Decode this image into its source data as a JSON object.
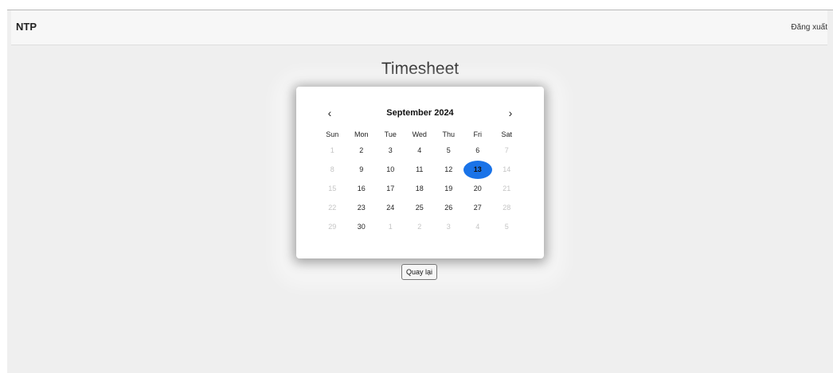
{
  "navbar": {
    "brand": "NTP",
    "logout_label": "Đăng xuất"
  },
  "page": {
    "title": "Timesheet"
  },
  "calendar": {
    "prev_icon": "chevron-left-icon",
    "next_icon": "chevron-right-icon",
    "month_label": "September 2024",
    "weekdays": [
      "Sun",
      "Mon",
      "Tue",
      "Wed",
      "Thu",
      "Fri",
      "Sat"
    ],
    "selected_day": "13",
    "selected_color": "#1a73e8",
    "weeks": [
      [
        {
          "d": "1",
          "muted": true
        },
        {
          "d": "2"
        },
        {
          "d": "3"
        },
        {
          "d": "4"
        },
        {
          "d": "5"
        },
        {
          "d": "6"
        },
        {
          "d": "7",
          "muted": true
        }
      ],
      [
        {
          "d": "8",
          "muted": true
        },
        {
          "d": "9"
        },
        {
          "d": "10"
        },
        {
          "d": "11"
        },
        {
          "d": "12"
        },
        {
          "d": "13",
          "selected": true
        },
        {
          "d": "14",
          "muted": true
        }
      ],
      [
        {
          "d": "15",
          "muted": true
        },
        {
          "d": "16"
        },
        {
          "d": "17"
        },
        {
          "d": "18"
        },
        {
          "d": "19"
        },
        {
          "d": "20"
        },
        {
          "d": "21",
          "muted": true
        }
      ],
      [
        {
          "d": "22",
          "muted": true
        },
        {
          "d": "23"
        },
        {
          "d": "24"
        },
        {
          "d": "25"
        },
        {
          "d": "26"
        },
        {
          "d": "27"
        },
        {
          "d": "28",
          "muted": true
        }
      ],
      [
        {
          "d": "29",
          "muted": true
        },
        {
          "d": "30"
        },
        {
          "d": "1",
          "muted": true
        },
        {
          "d": "2",
          "muted": true
        },
        {
          "d": "3",
          "muted": true
        },
        {
          "d": "4",
          "muted": true
        },
        {
          "d": "5",
          "muted": true
        }
      ]
    ]
  },
  "back_button": {
    "label": "Quay lại"
  }
}
